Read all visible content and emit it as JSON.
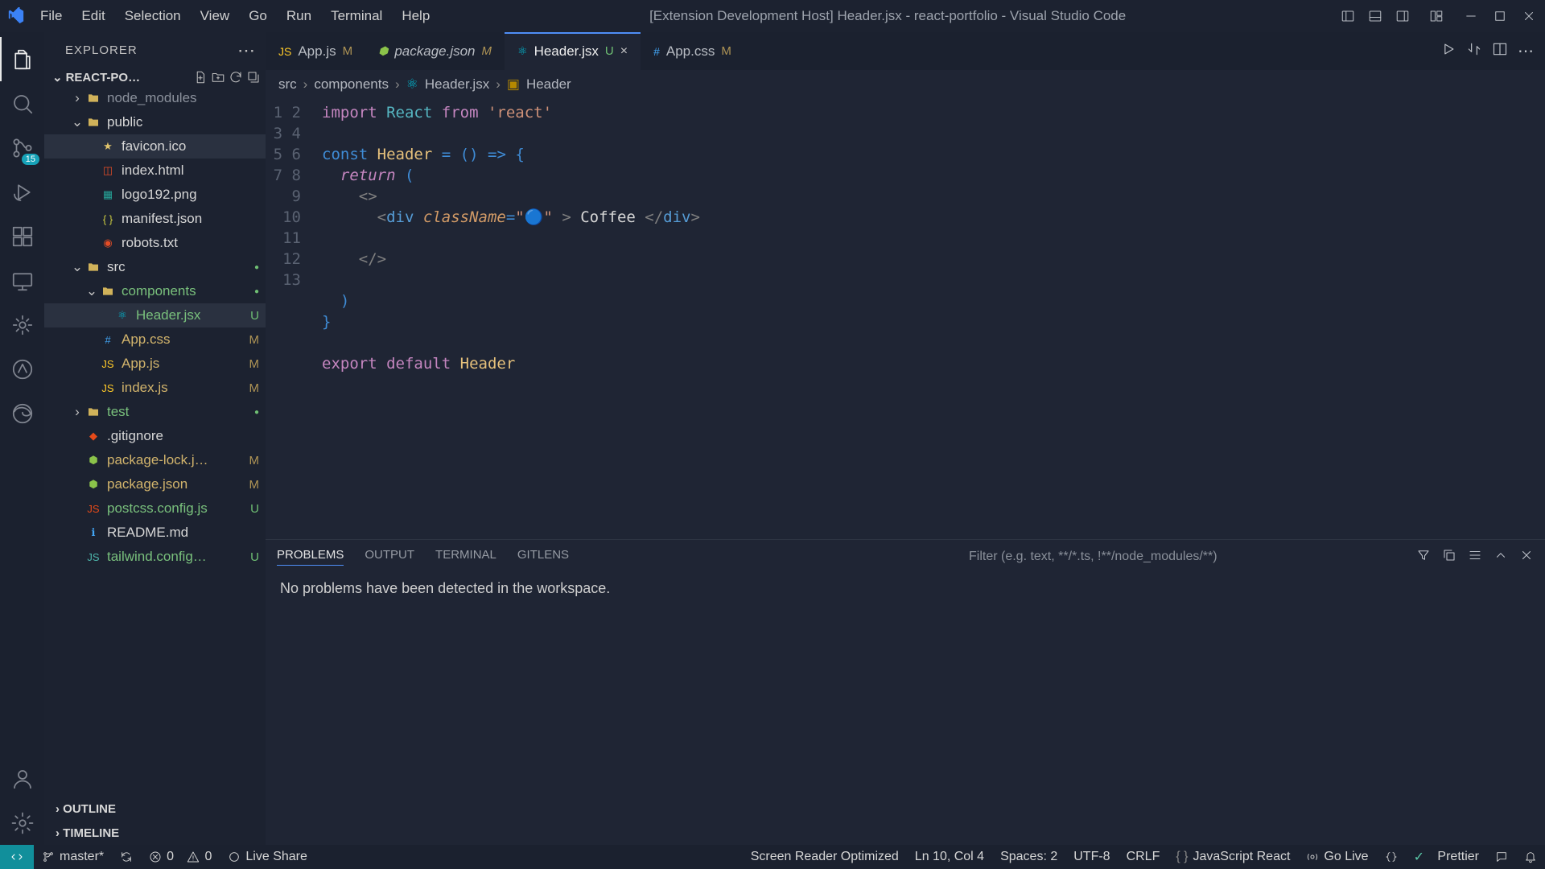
{
  "titlebar": {
    "menu": [
      "File",
      "Edit",
      "Selection",
      "View",
      "Go",
      "Run",
      "Terminal",
      "Help"
    ],
    "title": "[Extension Development Host] Header.jsx - react-portfolio - Visual Studio Code"
  },
  "activitybar": {
    "scm_badge": "15"
  },
  "sidebar": {
    "title": "EXPLORER",
    "folder": "REACT-PO…",
    "tree": [
      {
        "depth": 1,
        "type": "folder",
        "expand": "closed",
        "name": "node_modules",
        "cls": "muted-label"
      },
      {
        "depth": 1,
        "type": "folder",
        "expand": "open",
        "name": "public"
      },
      {
        "depth": 2,
        "type": "file",
        "icon": "star",
        "iconColor": "#e0c46c",
        "name": "favicon.ico",
        "selected": true
      },
      {
        "depth": 2,
        "type": "file",
        "icon": "html",
        "iconColor": "#e44d26",
        "name": "index.html"
      },
      {
        "depth": 2,
        "type": "file",
        "icon": "img",
        "iconColor": "#26a69a",
        "name": "logo192.png"
      },
      {
        "depth": 2,
        "type": "file",
        "icon": "json",
        "iconColor": "#cbcb41",
        "name": "manifest.json"
      },
      {
        "depth": 2,
        "type": "file",
        "icon": "robot",
        "iconColor": "#e44d26",
        "name": "robots.txt"
      },
      {
        "depth": 1,
        "type": "folder",
        "expand": "open",
        "name": "src",
        "status": "dot"
      },
      {
        "depth": 2,
        "type": "folder",
        "expand": "open",
        "name": "components",
        "cls": "green-label",
        "status": "dot"
      },
      {
        "depth": 3,
        "type": "file",
        "icon": "react",
        "iconColor": "#00bcd4",
        "name": "Header.jsx",
        "cls": "green-label",
        "status": "U",
        "selected": true
      },
      {
        "depth": 2,
        "type": "file",
        "icon": "css",
        "iconColor": "#42a5f5",
        "name": "App.css",
        "cls": "modified-label",
        "status": "M"
      },
      {
        "depth": 2,
        "type": "file",
        "icon": "js",
        "iconColor": "#ffca28",
        "name": "App.js",
        "cls": "modified-label",
        "status": "M"
      },
      {
        "depth": 2,
        "type": "file",
        "icon": "js",
        "iconColor": "#ffca28",
        "name": "index.js",
        "cls": "modified-label",
        "status": "M"
      },
      {
        "depth": 1,
        "type": "folder",
        "expand": "closed",
        "name": "test",
        "cls": "green-label",
        "status": "dot"
      },
      {
        "depth": 1,
        "type": "file",
        "icon": "git",
        "iconColor": "#e64a19",
        "name": ".gitignore"
      },
      {
        "depth": 1,
        "type": "file",
        "icon": "node",
        "iconColor": "#8bc34a",
        "name": "package-lock.j…",
        "cls": "modified-label",
        "status": "M"
      },
      {
        "depth": 1,
        "type": "file",
        "icon": "node",
        "iconColor": "#8bc34a",
        "name": "package.json",
        "cls": "modified-label",
        "status": "M"
      },
      {
        "depth": 1,
        "type": "file",
        "icon": "js",
        "iconColor": "#e64a19",
        "name": "postcss.config.js",
        "cls": "green-label",
        "status": "U"
      },
      {
        "depth": 1,
        "type": "file",
        "icon": "info",
        "iconColor": "#42a5f5",
        "name": "README.md"
      },
      {
        "depth": 1,
        "type": "file",
        "icon": "js",
        "iconColor": "#4db6ac",
        "name": "tailwind.config…",
        "cls": "green-label",
        "status": "U"
      }
    ],
    "outline": "OUTLINE",
    "timeline": "TIMELINE"
  },
  "tabs": [
    {
      "icon": "js",
      "iconColor": "#ffca28",
      "label": "App.js",
      "status": "M"
    },
    {
      "icon": "node",
      "iconColor": "#8bc34a",
      "label": "package.json",
      "status": "M",
      "italic": true
    },
    {
      "icon": "react",
      "iconColor": "#00bcd4",
      "label": "Header.jsx",
      "status": "U",
      "active": true,
      "close": true
    },
    {
      "icon": "css",
      "iconColor": "#42a5f5",
      "label": "App.css",
      "status": "M"
    }
  ],
  "breadcrumbs": {
    "parts": [
      "src",
      "components",
      "Header.jsx",
      "Header"
    ]
  },
  "editor": {
    "lines": 13
  },
  "panel": {
    "tabs": [
      "PROBLEMS",
      "OUTPUT",
      "TERMINAL",
      "GITLENS"
    ],
    "active": 0,
    "filter_placeholder": "Filter (e.g. text, **/*.ts, !**/node_modules/**)",
    "body": "No problems have been detected in the workspace."
  },
  "statusbar": {
    "branch": "master*",
    "errors": "0",
    "warnings": "0",
    "liveshare": "Live Share",
    "screenreader": "Screen Reader Optimized",
    "ln_col": "Ln 10, Col 4",
    "spaces": "Spaces: 2",
    "encoding": "UTF-8",
    "eol": "CRLF",
    "language": "JavaScript React",
    "golive": "Go Live",
    "prettier": "Prettier"
  }
}
